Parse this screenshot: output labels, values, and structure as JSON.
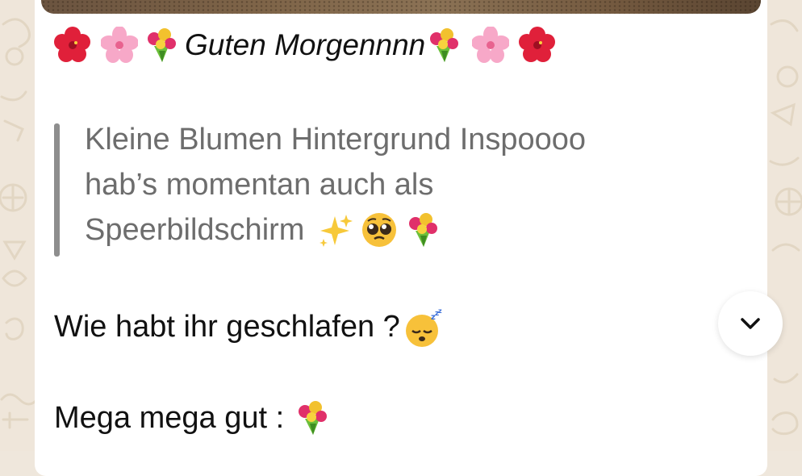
{
  "chat": {
    "greeting": {
      "text": "Guten Morgennnn",
      "leading_emojis": [
        "hibiscus",
        "cherry-blossom",
        "bouquet"
      ],
      "trailing_emojis": [
        "bouquet",
        "cherry-blossom",
        "hibiscus"
      ]
    },
    "quote": {
      "lines": [
        "Kleine Blumen Hintergrund Inspoooo",
        "hab’s momentan auch als",
        "Speerbildschirm"
      ],
      "trailing_emojis": [
        "sparkles",
        "pleading-face",
        "bouquet"
      ]
    },
    "question": {
      "text": "Wie habt ihr geschlafen ?",
      "emoji": "sleeping-face"
    },
    "answer": {
      "text": "Mega mega gut :",
      "emoji": "bouquet"
    }
  },
  "controls": {
    "scroll_down_icon": "chevron-down-icon"
  },
  "colors": {
    "wallpaper": "#efe6da",
    "bubble": "#ffffff",
    "text": "#111111",
    "quote_text": "#6d6d6d",
    "quote_bar": "#8e8e8e"
  }
}
